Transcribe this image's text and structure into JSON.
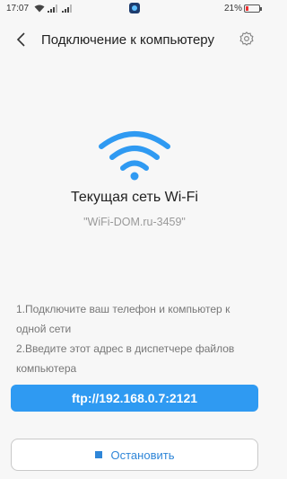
{
  "status_bar": {
    "time": "17:07",
    "battery_text": "21%",
    "battery_level": 0.21
  },
  "header": {
    "title": "Подключение к компьютеру"
  },
  "network": {
    "title": "Текущая сеть Wi-Fi",
    "ssid": "\"WiFi-DOM.ru-3459\""
  },
  "instructions": {
    "step1": "1.Подключите ваш телефон и компьютер к одной сети",
    "step2": "2.Введите этот адрес в диспетчере файлов компьютера"
  },
  "address": "ftp://192.168.0.7:2121",
  "stop_button": {
    "label": "Остановить"
  },
  "colors": {
    "accent": "#2f9af2",
    "stop_text": "#2f86d8",
    "background": "#f7f7f7"
  },
  "icons": {
    "back": "back-arrow-icon",
    "settings": "gear-icon",
    "wifi": "wifi-icon"
  }
}
